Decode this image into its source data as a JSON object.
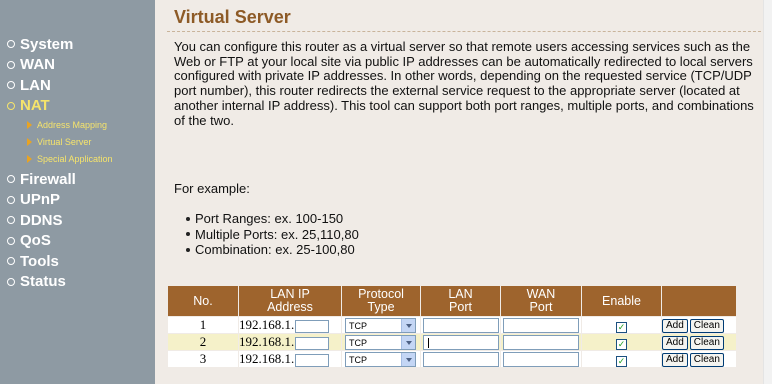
{
  "sidebar": {
    "items": [
      {
        "label": "System"
      },
      {
        "label": "WAN"
      },
      {
        "label": "LAN"
      },
      {
        "label": "NAT"
      },
      {
        "label": "Firewall"
      },
      {
        "label": "UPnP"
      },
      {
        "label": "DDNS"
      },
      {
        "label": "QoS"
      },
      {
        "label": "Tools"
      },
      {
        "label": "Status"
      }
    ],
    "nat_sub": [
      {
        "label": "Address Mapping"
      },
      {
        "label": "Virtual Server"
      },
      {
        "label": "Special Application"
      }
    ]
  },
  "main": {
    "title": "Virtual Server",
    "description": "You can configure this router as a virtual server so that remote users accessing services such as the Web or FTP at your local site via public IP addresses can be automatically redirected to local servers configured with private IP addresses. In other words, depending on the requested service (TCP/UDP port number), this router redirects the external service request to the appropriate server (located at another internal IP address). This tool can support both port ranges, multiple ports, and combinations of the two.",
    "example_heading": "For example:",
    "examples": [
      "Port Ranges: ex. 100-150",
      "Multiple Ports: ex. 25,110,80",
      "Combination: ex. 25-100,80"
    ]
  },
  "table": {
    "headers": {
      "no": "No.",
      "lan_ip_1": "LAN IP",
      "lan_ip_2": "Address",
      "proto_1": "Protocol",
      "proto_2": "Type",
      "lan_port_1": "LAN",
      "lan_port_2": "Port",
      "wan_port_1": "WAN",
      "wan_port_2": "Port",
      "enable": "Enable"
    },
    "rows": [
      {
        "no": "1",
        "ip_prefix": "192.168.1.",
        "protocol": "TCP",
        "enabled": true
      },
      {
        "no": "2",
        "ip_prefix": "192.168.1.",
        "protocol": "TCP",
        "enabled": true
      },
      {
        "no": "3",
        "ip_prefix": "192.168.1.",
        "protocol": "TCP",
        "enabled": true
      }
    ],
    "add_label": "Add",
    "clean_label": "Clean"
  },
  "colors": {
    "sidebar_bg": "#8e9aa3",
    "active_nav": "#f6e46b",
    "content_bg": "#f0ebe6",
    "title": "#8d5a26",
    "table_header": "#9e642d",
    "row_even": "#f5f1c9"
  }
}
